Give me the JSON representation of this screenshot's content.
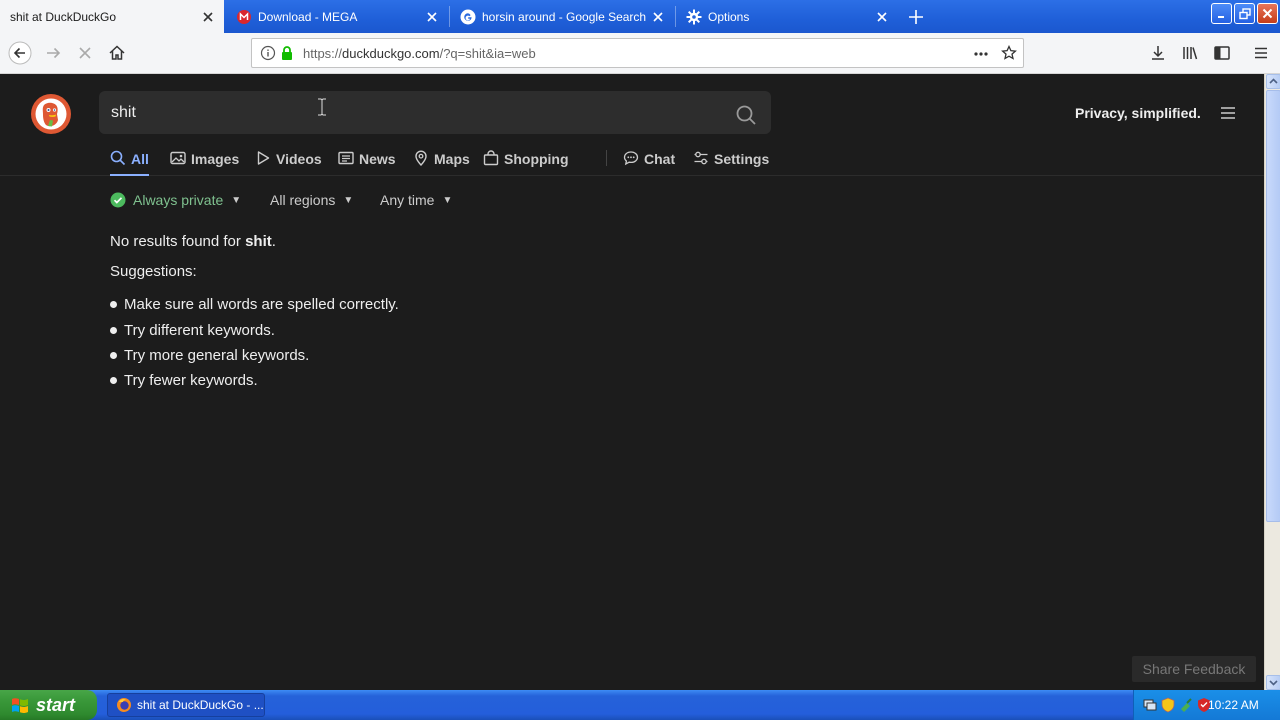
{
  "browser": {
    "tabs": [
      {
        "title": "shit at DuckDuckGo",
        "active": true,
        "icon": "duckduckgo-icon"
      },
      {
        "title": "Download - MEGA",
        "active": false,
        "icon": "mega-icon"
      },
      {
        "title": "horsin around - Google Search",
        "active": false,
        "icon": "google-icon"
      },
      {
        "title": "Options",
        "active": false,
        "icon": "gear-icon"
      }
    ],
    "url": {
      "prefix": "https://",
      "domain": "duckduckgo.com",
      "path": "/?q=shit&ia=web"
    }
  },
  "ddg": {
    "search_query": "shit",
    "tagline": "Privacy, simplified.",
    "tabs": [
      {
        "label": "All",
        "icon": "search-icon",
        "active": true
      },
      {
        "label": "Images",
        "icon": "image-icon"
      },
      {
        "label": "Videos",
        "icon": "play-icon"
      },
      {
        "label": "News",
        "icon": "news-icon"
      },
      {
        "label": "Maps",
        "icon": "map-pin-icon"
      },
      {
        "label": "Shopping",
        "icon": "shopping-bag-icon"
      },
      {
        "label": "Chat",
        "icon": "chat-icon"
      },
      {
        "label": "Settings",
        "icon": "settings-sliders-icon"
      }
    ],
    "filters": {
      "privacy": "Always private",
      "region": "All regions",
      "time": "Any time"
    },
    "no_results": {
      "prefix": "No results found for ",
      "query": "shit",
      "suffix": "."
    },
    "suggestions_title": "Suggestions:",
    "suggestions": [
      "Make sure all words are spelled correctly.",
      "Try different keywords.",
      "Try more general keywords.",
      "Try fewer keywords."
    ],
    "feedback_label": "Share Feedback"
  },
  "taskbar": {
    "start_label": "start",
    "task_item": "shit at DuckDuckGo - ...",
    "clock": "10:22 AM"
  },
  "colors": {
    "accent": "#8bb0ff",
    "ddg_orange": "#de5833",
    "private_green": "#4cba5e",
    "xp_blue": "#245edb",
    "xp_green": "#3b9a3b"
  }
}
